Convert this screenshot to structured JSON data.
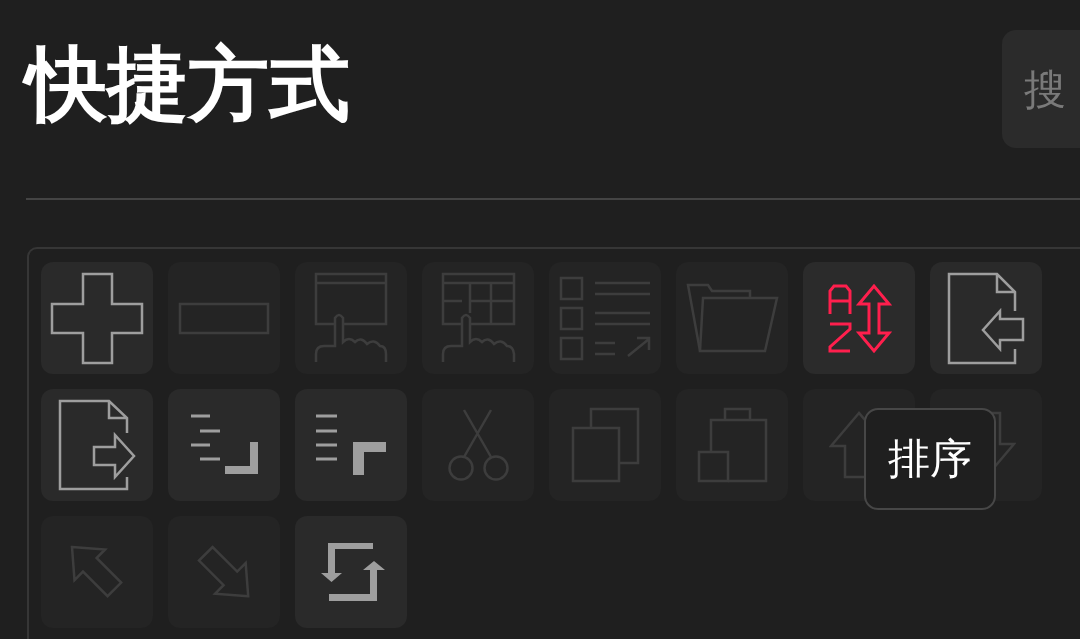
{
  "page": {
    "title": "快捷方式"
  },
  "search": {
    "placeholder": "搜"
  },
  "shortcuts": [
    {
      "kind": "add",
      "disabled": false,
      "hovered": false
    },
    {
      "kind": "remove",
      "disabled": true,
      "hovered": false
    },
    {
      "kind": "window",
      "disabled": true,
      "hovered": false
    },
    {
      "kind": "table",
      "disabled": true,
      "hovered": false
    },
    {
      "kind": "checklist",
      "disabled": true,
      "hovered": false
    },
    {
      "kind": "folder",
      "disabled": true,
      "hovered": false
    },
    {
      "kind": "sort",
      "disabled": false,
      "hovered": true
    },
    {
      "kind": "import",
      "disabled": false,
      "hovered": false
    },
    {
      "kind": "export",
      "disabled": false,
      "hovered": false
    },
    {
      "kind": "outdent",
      "disabled": false,
      "hovered": false
    },
    {
      "kind": "indent",
      "disabled": false,
      "hovered": false
    },
    {
      "kind": "cut",
      "disabled": true,
      "hovered": false
    },
    {
      "kind": "copy",
      "disabled": true,
      "hovered": false
    },
    {
      "kind": "paste",
      "disabled": true,
      "hovered": false
    },
    {
      "kind": "up",
      "disabled": true,
      "hovered": false
    },
    {
      "kind": "down",
      "disabled": true,
      "hovered": false
    },
    {
      "kind": "upleft",
      "disabled": true,
      "hovered": false
    },
    {
      "kind": "downright",
      "disabled": true,
      "hovered": false
    },
    {
      "kind": "swap",
      "disabled": false,
      "hovered": false
    }
  ],
  "tooltip": {
    "text": "排序"
  }
}
